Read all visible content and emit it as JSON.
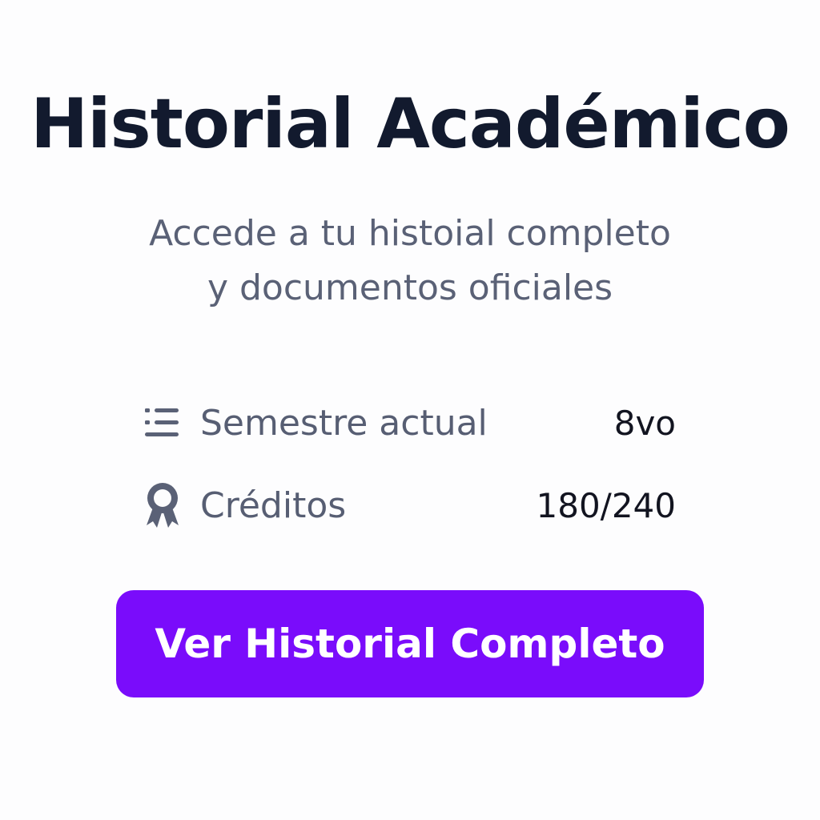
{
  "header": {
    "title": "Historial Académico",
    "subtitle_line1": "Accede a tu histoial completo",
    "subtitle_line2": "y documentos oficiales"
  },
  "stats": [
    {
      "icon": "list-icon",
      "label": "Semestre actual",
      "value": "8vo"
    },
    {
      "icon": "award-ribbon-icon",
      "label": "Créditos",
      "value": "180/240"
    }
  ],
  "cta": {
    "label": "Ver Historial Completo"
  },
  "colors": {
    "accent": "#7a0cfb",
    "title": "#121a2e",
    "muted_text": "#5a6176",
    "value_text": "#121420",
    "icon": "#5a6176",
    "background": "#fdfdfe"
  }
}
